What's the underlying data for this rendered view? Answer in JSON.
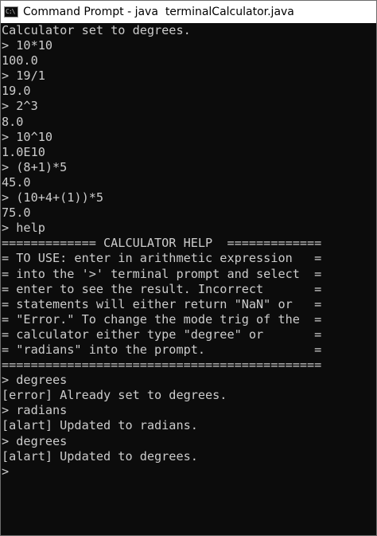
{
  "window": {
    "title": "Command Prompt - java  terminalCalculator.java",
    "icon": "C:\\"
  },
  "console": {
    "lines": [
      "Calculator set to degrees.",
      "> 10*10",
      "100.0",
      "> 19/1",
      "19.0",
      "> 2^3",
      "8.0",
      "> 10^10",
      "1.0E10",
      "> (8+1)*5",
      "45.0",
      "> (10+4+(1))*5",
      "75.0",
      "> help",
      "============= CALCULATOR HELP  =============",
      "= TO USE: enter in arithmetic expression   =",
      "= into the '>' terminal prompt and select  =",
      "= enter to see the result. Incorrect       =",
      "= statements will either return \"NaN\" or   =",
      "= \"Error.\" To change the mode trig of the  =",
      "= calculator either type \"degree\" or       =",
      "= \"radians\" into the prompt.               =",
      "============================================",
      "> degrees",
      "[error] Already set to degrees.",
      "> radians",
      "[alart] Updated to radians.",
      "> degrees",
      "[alart] Updated to degrees.",
      ">"
    ]
  },
  "colors": {
    "background": "#0c0c0c",
    "text": "#cccccc",
    "titlebar": "#ffffff"
  }
}
